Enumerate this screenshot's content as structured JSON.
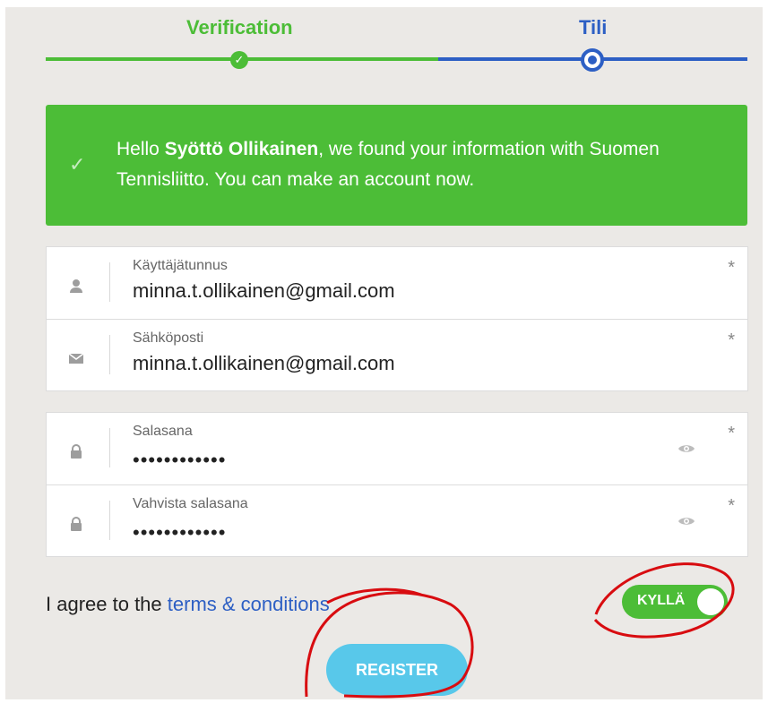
{
  "steps": {
    "done": "Verification",
    "current": "Tili"
  },
  "banner": {
    "prefix": "Hello ",
    "name": "Syöttö Ollikainen",
    "suffix": ", we found your information with Suomen Tennisliitto. You can make an account now."
  },
  "fields": {
    "username": {
      "label": "Käyttäjätunnus",
      "value": "minna.t.ollikainen@gmail.com"
    },
    "email": {
      "label": "Sähköposti",
      "value": "minna.t.ollikainen@gmail.com"
    },
    "password": {
      "label": "Salasana",
      "value": "••••••••••••"
    },
    "confirm": {
      "label": "Vahvista salasana",
      "value": "••••••••••••"
    },
    "required_mark": "*"
  },
  "agreement": {
    "prefix": "I agree to the ",
    "link": "terms & conditions"
  },
  "toggle": {
    "label": "KYLLÄ"
  },
  "register": {
    "label": "REGISTER"
  },
  "colors": {
    "accent_green": "#4cbd37",
    "accent_blue": "#2d5fc4",
    "button_blue": "#58c8ea",
    "annotation_red": "#d80c10"
  },
  "icons": {
    "user": "user-icon",
    "email": "envelope-icon",
    "lock": "lock-icon",
    "eye": "eye-icon"
  }
}
